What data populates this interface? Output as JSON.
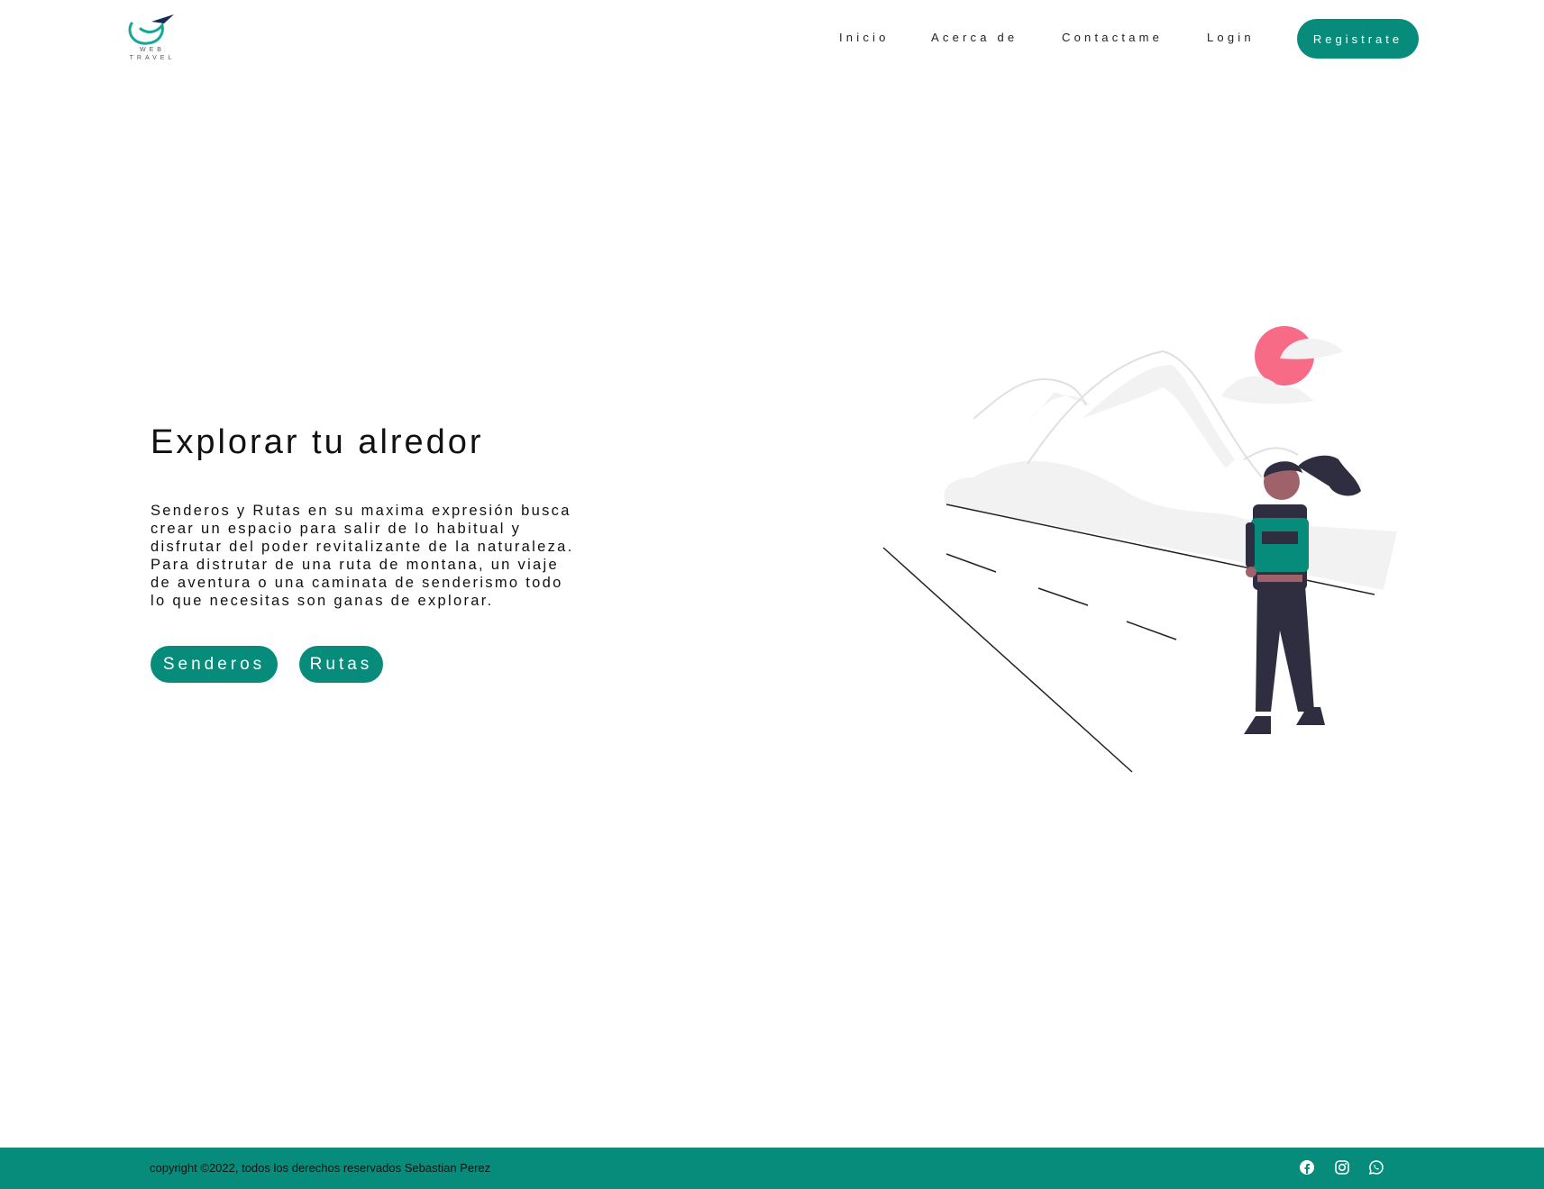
{
  "header": {
    "logo": {
      "line1": "WEB",
      "line2": "TRAVEL"
    },
    "nav": [
      "Inicio",
      "Acerca de",
      "Contactame",
      "Login"
    ],
    "register_label": "Registrate"
  },
  "hero": {
    "title": "Explorar tu alredor",
    "paragraph": "Senderos y Rutas en su maxima expresión busca crear un espacio para salir de lo habitual y disfrutar del poder revitalizante de la naturaleza. Para distrutar de una ruta de montana, un viaje de aventura o una caminata de senderismo todo lo que necesitas son ganas de explorar.",
    "buttons": [
      "Senderos",
      "Rutas"
    ]
  },
  "footer": {
    "copyright": "copyright ©2022, todos los derechos reservados Sebastian Perez",
    "social_icons": [
      "facebook-icon",
      "instagram-icon",
      "whatsapp-icon"
    ]
  },
  "colors": {
    "accent": "#078c7c",
    "sun": "#f76b87",
    "dark": "#2f2e41"
  }
}
